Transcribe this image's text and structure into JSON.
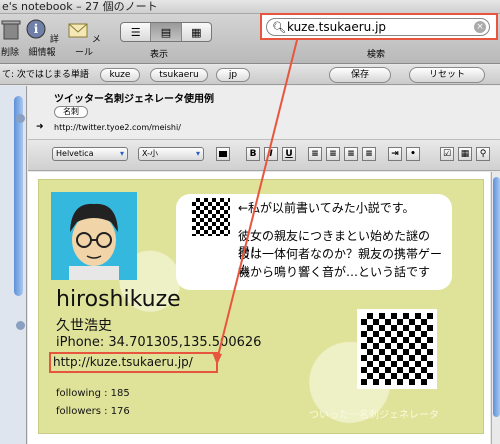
{
  "window": {
    "title": "e's notebook – 27 個のノート"
  },
  "toolbar": {
    "delete_label": "削除",
    "info_label": "詳細情報",
    "mail_label": "メール",
    "view_label": "表示",
    "search_label": "検索",
    "search_value": "kuze.tsukaeru.jp"
  },
  "filter": {
    "prefix": "て: 次ではじまる単語",
    "tags": [
      "kuze",
      "tsukaeru",
      "jp"
    ],
    "save_label": "保存",
    "reset_label": "リセット"
  },
  "note": {
    "title": "ツイッター名刺ジェネレータ使用例",
    "tag": "名刺",
    "url": "http://twitter.tyoe2.com/meishi/"
  },
  "format": {
    "font": "Helvetica",
    "size": "X-小",
    "bold": "B",
    "italic": "I",
    "underline": "U"
  },
  "card": {
    "bubble_lines": [
      "←私が以前書いてみた小説です。",
      "彼女の親友につきまとい始めた謎の男！",
      "彼は一体何者なのか？親友の携帯ゲーム",
      "機から鳴り響く音が…という話です"
    ],
    "name": "hiroshikuze",
    "name_jp": "久世浩史",
    "iphone": "iPhone:  34.701305,135.500626",
    "link": "http://kuze.tsukaeru.jp/",
    "following": "following : 185",
    "followers": "followers : 176",
    "footer": "ついった一名刺ジェネレータ"
  },
  "colors": {
    "highlight": "#e8553e",
    "card_bg": "#dfe39a",
    "accent": "#5e91d8"
  }
}
